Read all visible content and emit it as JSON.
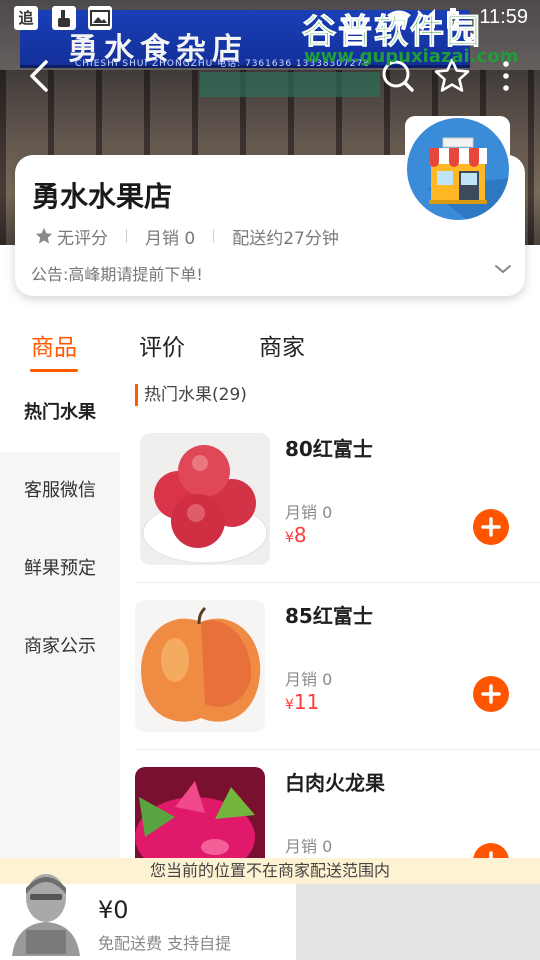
{
  "status_bar": {
    "time": "11:59",
    "icons": [
      "app-icon-zhui",
      "app-icon-hand",
      "image-icon",
      "wifi-icon",
      "signal-icon",
      "battery-charging-icon"
    ],
    "app_glyph": "追"
  },
  "banner": {
    "sign_text": "勇水食杂店",
    "sign_sub": "CHIESHI SHUI  ZHONGZHU  电话: 7361636  13338307278"
  },
  "nav": {
    "back": "back-arrow-icon",
    "search": "search-icon",
    "favorite": "star-outline-icon",
    "more": "more-vertical-icon"
  },
  "shop": {
    "name": "勇水水果店",
    "rating": "无评分",
    "monthly_sales": "月销 0",
    "delivery_time": "配送约27分钟",
    "notice": "公告:高峰期请提前下单!"
  },
  "tabs": [
    {
      "label": "商品",
      "active": true
    },
    {
      "label": "评价",
      "active": false
    },
    {
      "label": "商家",
      "active": false
    }
  ],
  "sidebar": {
    "items": [
      {
        "label": "热门水果",
        "active": true
      },
      {
        "label": "客服微信",
        "active": false
      },
      {
        "label": "鲜果预定",
        "active": false
      },
      {
        "label": "商家公示",
        "active": false
      }
    ]
  },
  "section": {
    "title": "热门水果(29)"
  },
  "products": [
    {
      "name": "80红富士",
      "sales": "月销 0",
      "currency": "¥",
      "price": "8",
      "image": "apples-plate"
    },
    {
      "name": "85红富士",
      "sales": "月销 0",
      "currency": "¥",
      "price": "11",
      "image": "single-apple"
    },
    {
      "name": "白肉火龙果",
      "sales": "月销 0",
      "currency": "¥",
      "price": "",
      "image": "dragon-fruit"
    }
  ],
  "warning": "您当前的位置不在商家配送范围内",
  "cart": {
    "price": "¥0",
    "desc": "免配送费  支持自提"
  },
  "watermark": {
    "title": "谷普软件园",
    "url": "www.gupuxiazai.com"
  },
  "colors": {
    "accent": "#ff5a00",
    "price": "#ff3b3b",
    "warning_bg": "#fdf2d2"
  }
}
